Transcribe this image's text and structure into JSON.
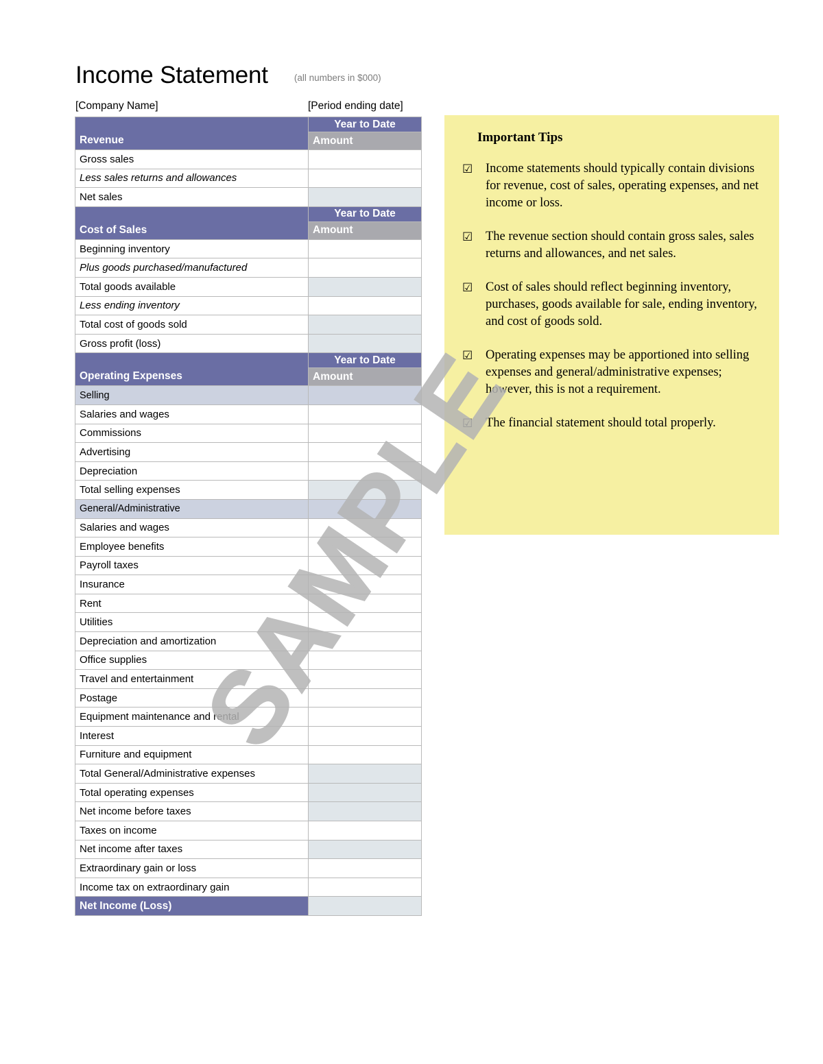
{
  "document": {
    "title": "Income Statement",
    "subtitle": "(all numbers in $000)",
    "company_placeholder": "[Company Name]",
    "period_placeholder": "[Period ending date]",
    "watermark": "SAMPLE"
  },
  "table": {
    "column_headers": {
      "year_to_date": "Year to Date",
      "amount": "Amount"
    },
    "sections": [
      {
        "heading": "Revenue",
        "rows": [
          {
            "label": "Gross sales",
            "italic": false,
            "shaded": false,
            "value": ""
          },
          {
            "label": "Less sales returns and allowances",
            "italic": true,
            "shaded": false,
            "value": ""
          },
          {
            "label": "Net sales",
            "italic": false,
            "shaded": true,
            "value": ""
          }
        ]
      },
      {
        "heading": "Cost of Sales",
        "rows": [
          {
            "label": "Beginning inventory",
            "italic": false,
            "shaded": false,
            "value": ""
          },
          {
            "label": "Plus goods purchased/manufactured",
            "italic": true,
            "shaded": false,
            "value": ""
          },
          {
            "label": "Total goods available",
            "italic": false,
            "shaded": true,
            "value": ""
          },
          {
            "label": "Less ending inventory",
            "italic": true,
            "shaded": false,
            "value": ""
          },
          {
            "label": "Total cost of goods sold",
            "italic": false,
            "shaded": true,
            "value": ""
          },
          {
            "label": "Gross profit (loss)",
            "italic": false,
            "shaded": true,
            "value": ""
          }
        ]
      },
      {
        "heading": "Operating Expenses",
        "rows": [
          {
            "label": "Selling",
            "subheader": true,
            "italic": false,
            "shaded": false,
            "value": ""
          },
          {
            "label": "Salaries and wages",
            "italic": false,
            "shaded": false,
            "value": ""
          },
          {
            "label": "Commissions",
            "italic": false,
            "shaded": false,
            "value": ""
          },
          {
            "label": "Advertising",
            "italic": false,
            "shaded": false,
            "value": ""
          },
          {
            "label": "Depreciation",
            "italic": false,
            "shaded": false,
            "value": ""
          },
          {
            "label": "Total selling expenses",
            "italic": false,
            "shaded": true,
            "value": ""
          },
          {
            "label": "General/Administrative",
            "subheader": true,
            "italic": false,
            "shaded": false,
            "value": ""
          },
          {
            "label": "Salaries and wages",
            "italic": false,
            "shaded": false,
            "value": ""
          },
          {
            "label": "Employee benefits",
            "italic": false,
            "shaded": false,
            "value": ""
          },
          {
            "label": "Payroll taxes",
            "italic": false,
            "shaded": false,
            "value": ""
          },
          {
            "label": "Insurance",
            "italic": false,
            "shaded": false,
            "value": ""
          },
          {
            "label": "Rent",
            "italic": false,
            "shaded": false,
            "value": ""
          },
          {
            "label": "Utilities",
            "italic": false,
            "shaded": false,
            "value": ""
          },
          {
            "label": "Depreciation and amortization",
            "italic": false,
            "shaded": false,
            "value": ""
          },
          {
            "label": "Office supplies",
            "italic": false,
            "shaded": false,
            "value": ""
          },
          {
            "label": "Travel and entertainment",
            "italic": false,
            "shaded": false,
            "value": ""
          },
          {
            "label": "Postage",
            "italic": false,
            "shaded": false,
            "value": ""
          },
          {
            "label": "Equipment maintenance and rental",
            "italic": false,
            "shaded": false,
            "value": ""
          },
          {
            "label": "Interest",
            "italic": false,
            "shaded": false,
            "value": ""
          },
          {
            "label": "Furniture and equipment",
            "italic": false,
            "shaded": false,
            "value": ""
          },
          {
            "label": "Total General/Administrative expenses",
            "italic": false,
            "shaded": true,
            "value": ""
          },
          {
            "label": "Total operating expenses",
            "italic": false,
            "shaded": true,
            "value": ""
          },
          {
            "label": "Net income before taxes",
            "italic": false,
            "shaded": true,
            "value": ""
          },
          {
            "label": "Taxes on income",
            "italic": false,
            "shaded": false,
            "value": ""
          },
          {
            "label": "Net income after taxes",
            "italic": false,
            "shaded": true,
            "value": ""
          },
          {
            "label": "Extraordinary gain or loss",
            "italic": false,
            "shaded": false,
            "value": ""
          },
          {
            "label": "Income tax on extraordinary gain",
            "italic": false,
            "shaded": false,
            "value": ""
          }
        ]
      }
    ],
    "total_row": {
      "label": "Net Income (Loss)",
      "value": ""
    }
  },
  "tips": {
    "title": "Important Tips",
    "check_glyph": "☑",
    "items": [
      "Income statements should typically contain divisions for revenue, cost of sales, operating expenses, and net income or loss.",
      "The revenue section should contain gross sales, sales returns and allowances, and net sales.",
      "Cost of sales should reflect beginning inventory, purchases, goods available for sale, ending inventory, and cost of goods sold.",
      "Operating expenses may be apportioned into selling expenses and general/administrative expenses; however, this is not a requirement.",
      "The financial statement should total properly."
    ]
  },
  "colors": {
    "section_purple": "#6a6ea4",
    "amount_gray": "#a9a9ae",
    "subsection_lavender": "#ccd2e0",
    "shaded_cell": "#e0e6ea",
    "tips_yellow": "#f6f0a2",
    "watermark_gray": "#b4b4b4"
  }
}
